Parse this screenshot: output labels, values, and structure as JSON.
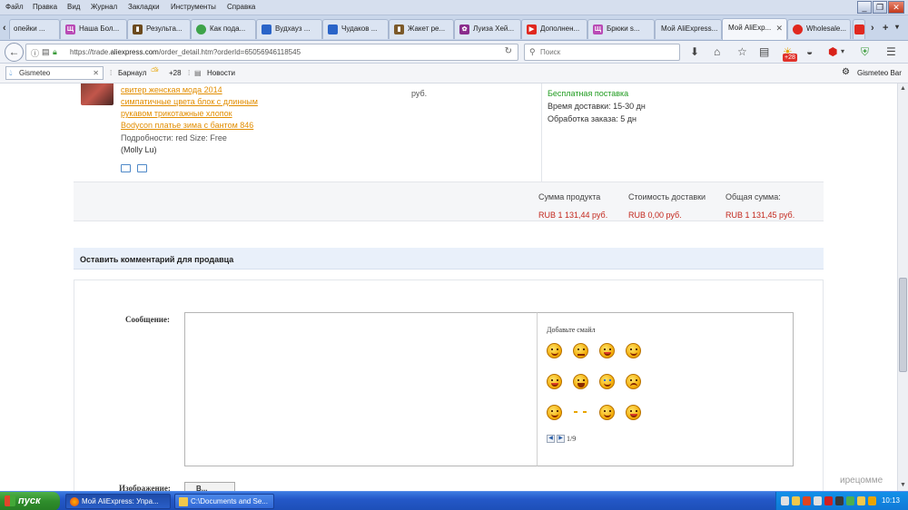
{
  "menubar": {
    "items": [
      "Файл",
      "Правка",
      "Вид",
      "Журнал",
      "Закладки",
      "Инструменты",
      "Справка"
    ]
  },
  "tabs": [
    {
      "label": "опейки ..."
    },
    {
      "label": "Наша Бол..."
    },
    {
      "label": "Результа..."
    },
    {
      "label": "Как пода..."
    },
    {
      "label": "Вудхауз ..."
    },
    {
      "label": "Чудаков ..."
    },
    {
      "label": "Жакет ре..."
    },
    {
      "label": "Луиза Хей..."
    },
    {
      "label": "Дополнен..."
    },
    {
      "label": "Брюки s..."
    },
    {
      "label": "Мой AliExpress..."
    },
    {
      "label": "Мой AliExp..."
    },
    {
      "label": "Wholesale..."
    }
  ],
  "navbar": {
    "url_host": "https://trade.",
    "url_domain": "aliexpress.com",
    "url_path": "/order_detail.htm?orderId=65056946118545",
    "search_placeholder": "Поиск",
    "weather_badge": "+28"
  },
  "gismeteo": {
    "select_label": "Gismeteo",
    "city": "Барнаул",
    "temp": "+28",
    "news": "Новости",
    "bar_label": "Gismeteo Bar"
  },
  "product": {
    "title_lines": [
      "свитер женская мода 2014",
      "симпатичные цвета блок с длинным",
      "рукавом трикотажные хлопок",
      "Bodycon платье зима с бантом 846"
    ],
    "details": "Подробности: red      Size: Free",
    "seller": "(Molly Lu)",
    "price_unit": "руб.",
    "shipping": "Бесплатная поставка",
    "delivery_time": "Время доставки: 15-30 дн",
    "processing_time": "Обработка заказа: 5 дн"
  },
  "summary": {
    "product_sum_label": "Сумма продукта",
    "product_sum_value": "RUB 1 131,44 руб.",
    "shipping_label": "Стоимость доставки",
    "shipping_value": "RUB 0,00 руб.",
    "total_label": "Общая сумма:",
    "total_value": "RUB 1 131,45 руб."
  },
  "comment": {
    "heading": "Оставить комментарий для продавца",
    "message_label": "Сообщение:",
    "smiles_title": "Добавьте смайл",
    "pager": "1/9",
    "image_label": "Изображение:",
    "image_button": "В..."
  },
  "watermark": "ирецомме",
  "taskbar": {
    "start": "пуск",
    "items": [
      "Мой AliExpress: Упра...",
      "C:\\Documents and Se..."
    ],
    "clock": "10:13"
  }
}
